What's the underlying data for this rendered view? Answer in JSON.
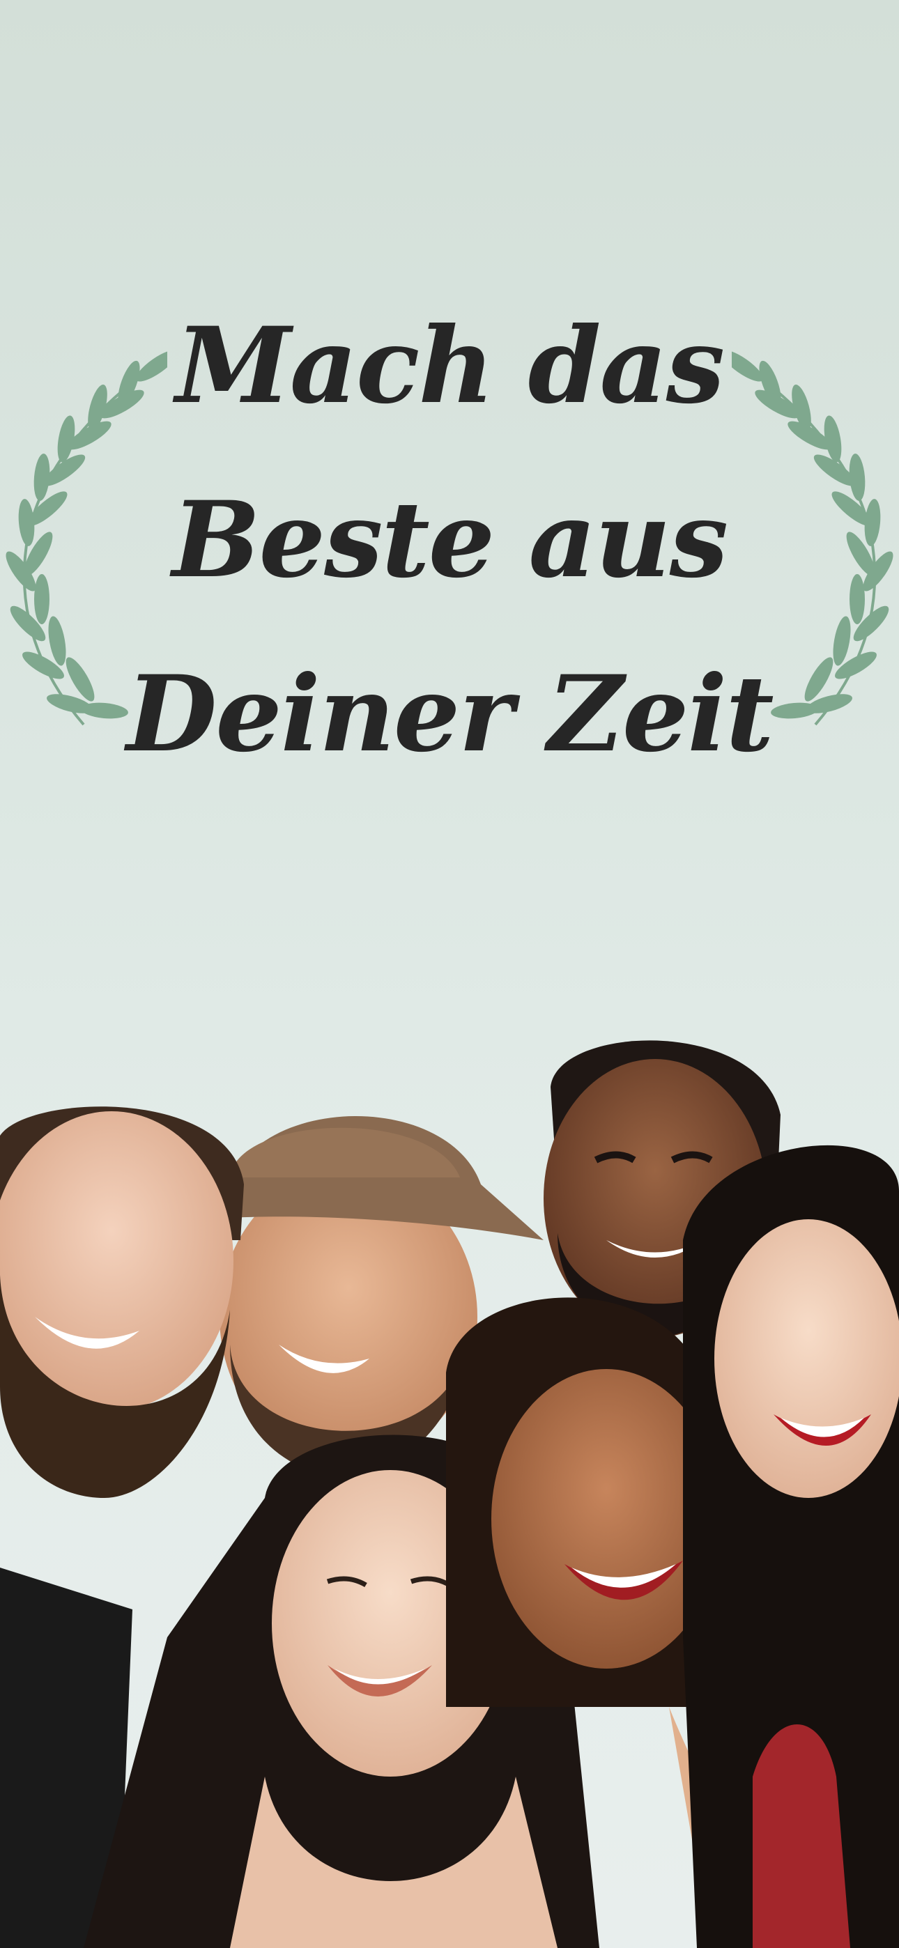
{
  "onboarding": {
    "headline_lines": [
      "Mach das",
      "Beste aus",
      "Deiner Zeit"
    ],
    "illustration": "group-of-smiling-friends-photo",
    "decoration_icon": "laurel-branch-icon"
  },
  "colors": {
    "background_top": "#d3dfd8",
    "background_bottom": "#e8eeed",
    "headline": "#262626",
    "laurel": "#7fa88e"
  }
}
